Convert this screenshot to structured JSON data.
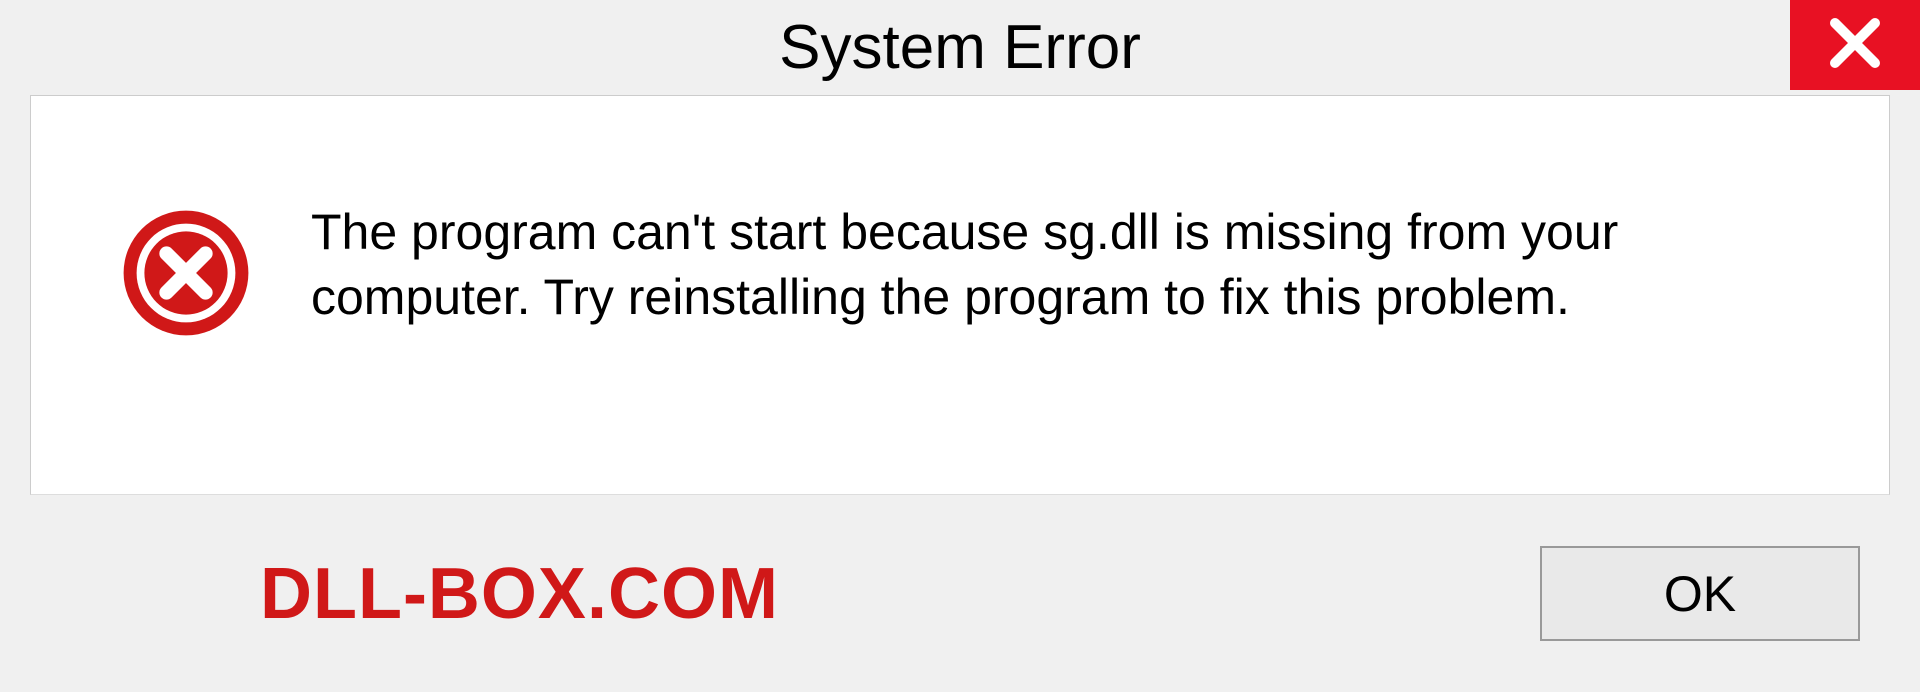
{
  "titlebar": {
    "title": "System Error"
  },
  "content": {
    "message": "The program can't start because sg.dll is missing from your computer. Try reinstalling the program to fix this problem."
  },
  "footer": {
    "watermark": "DLL-BOX.COM",
    "ok_label": "OK"
  }
}
